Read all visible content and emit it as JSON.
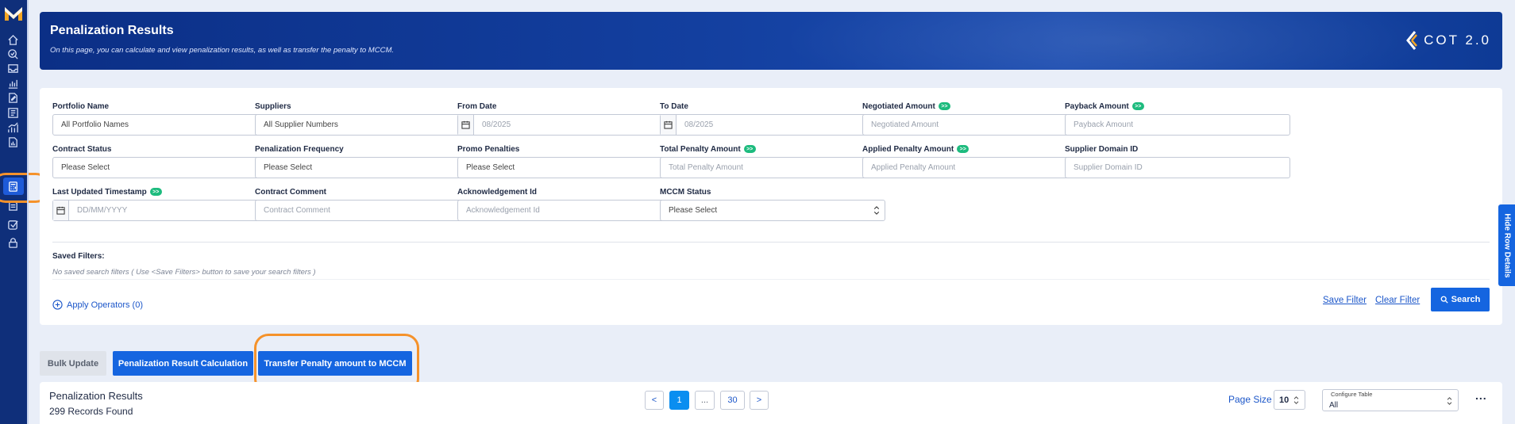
{
  "banner": {
    "title": "Penalization Results",
    "subtitle": "On this page, you can calculate and view penalization results, as well as transfer the penalty to MCCM.",
    "brand": "COT 2.0"
  },
  "filters": [
    {
      "label": "Portfolio Name",
      "type": "dropdown",
      "value": "All Portfolio Names",
      "badge": false
    },
    {
      "label": "Suppliers",
      "type": "dropdown",
      "value": "All Supplier Numbers",
      "badge": false
    },
    {
      "label": "From Date",
      "type": "date",
      "placeholder": "08/2025",
      "badge": false
    },
    {
      "label": "To Date",
      "type": "date",
      "placeholder": "08/2025",
      "badge": false
    },
    {
      "label": "Negotiated Amount",
      "type": "text",
      "placeholder": "Negotiated Amount",
      "badge": true
    },
    {
      "label": "Payback Amount",
      "type": "text",
      "placeholder": "Payback Amount",
      "badge": true
    },
    {
      "label": "Contract Status",
      "type": "select",
      "value": "Please Select",
      "badge": false
    },
    {
      "label": "Penalization Frequency",
      "type": "select",
      "value": "Please Select",
      "badge": false
    },
    {
      "label": "Promo Penalties",
      "type": "select",
      "value": "Please Select",
      "badge": false
    },
    {
      "label": "Total Penalty Amount",
      "type": "text",
      "placeholder": "Total Penalty Amount",
      "badge": true
    },
    {
      "label": "Applied Penalty Amount",
      "type": "text",
      "placeholder": "Applied Penalty Amount",
      "badge": true
    },
    {
      "label": "Supplier Domain ID",
      "type": "text",
      "placeholder": "Supplier Domain ID",
      "badge": false
    },
    {
      "label": "Last Updated Timestamp",
      "type": "date",
      "placeholder": "DD/MM/YYYY",
      "badge": true
    },
    {
      "label": "Contract Comment",
      "type": "text",
      "placeholder": "Contract Comment",
      "badge": false
    },
    {
      "label": "Acknowledgement Id",
      "type": "text",
      "placeholder": "Acknowledgement Id",
      "badge": false
    },
    {
      "label": "MCCM Status",
      "type": "select",
      "value": "Please Select",
      "badge": false
    }
  ],
  "badge_text": ">>",
  "saved_filters": {
    "label": "Saved Filters:",
    "empty_text": "No saved search filters ( Use <Save Filters> button to save your search filters )"
  },
  "actions": {
    "apply_operators": "Apply Operators (0)",
    "save_filter": "Save Filter",
    "clear_filter": "Clear Filter",
    "search": "Search"
  },
  "side_tab": "Hide Row Details",
  "tabs": {
    "bulk_update": "Bulk Update",
    "calculation": "Penalization Result Calculation",
    "transfer": "Transfer Penalty amount to MCCM"
  },
  "results": {
    "title": "Penalization Results",
    "count": "299 Records Found",
    "pagination": {
      "prev": "<",
      "current": "1",
      "ellipsis": "...",
      "last": "30",
      "next": ">"
    },
    "page_size_label": "Page Size",
    "page_size": "10",
    "configure_label": "Configure Table",
    "configure_value": "All",
    "more": "..."
  },
  "colors": {
    "primary": "#1565e0",
    "banner": "#0b2f86",
    "sidebar": "#0f2f7a",
    "highlight": "#f5922b",
    "badge": "#1dbb7e"
  },
  "sidebar_icons": [
    "home-icon",
    "search-check-icon",
    "inbox-icon",
    "bar-chart-icon",
    "document-edit-icon",
    "list-icon",
    "chart-growth-icon",
    "document-chart-icon",
    "calculator-icon",
    "document-list-icon",
    "checkbox-icon",
    "lock-icon"
  ]
}
